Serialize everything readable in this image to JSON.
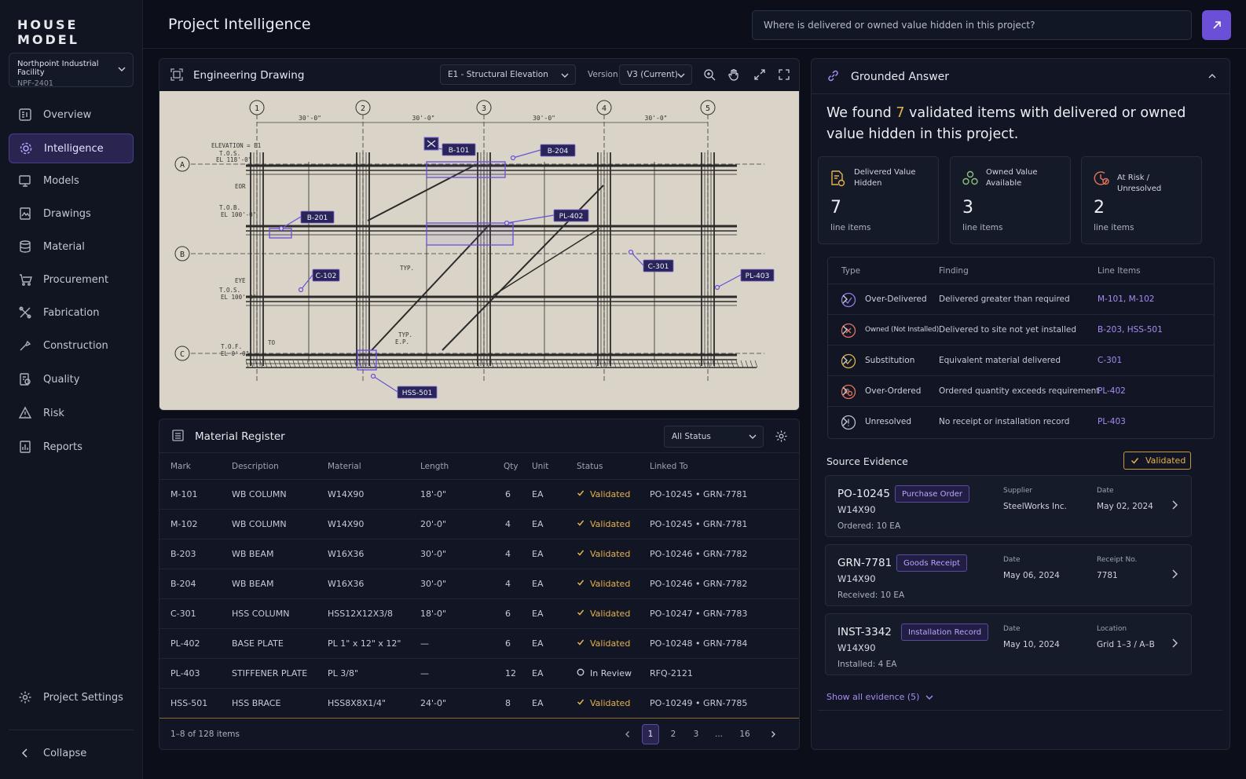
{
  "app": {
    "brand": "HOUSE MODEL"
  },
  "project": {
    "name": "Northpoint Industrial Facility",
    "code": "NPF-2401"
  },
  "nav": {
    "items": [
      {
        "label": "Overview",
        "icon": "overview-icon",
        "active": false
      },
      {
        "label": "Intelligence",
        "icon": "intelligence-icon",
        "active": true
      },
      {
        "label": "Models",
        "icon": "models-icon",
        "active": false
      },
      {
        "label": "Drawings",
        "icon": "drawings-icon",
        "active": false
      },
      {
        "label": "Material",
        "icon": "material-icon",
        "active": false
      },
      {
        "label": "Procurement",
        "icon": "procurement-icon",
        "active": false
      },
      {
        "label": "Fabrication",
        "icon": "fabrication-icon",
        "active": false
      },
      {
        "label": "Construction",
        "icon": "construction-icon",
        "active": false
      },
      {
        "label": "Quality",
        "icon": "quality-icon",
        "active": false
      },
      {
        "label": "Risk",
        "icon": "risk-icon",
        "active": false
      },
      {
        "label": "Reports",
        "icon": "reports-icon",
        "active": false
      }
    ],
    "settings_label": "Project Settings",
    "collapse_label": "Collapse"
  },
  "header": {
    "title": "Project Intelligence",
    "ask_placeholder": "Where is delivered or owned value hidden in this project?"
  },
  "drawing": {
    "title": "Engineering Drawing",
    "sheet": "E1 - Structural Elevation",
    "version_label": "Version",
    "version": "V3 (Current)",
    "grid_columns": [
      "1",
      "2",
      "3",
      "4",
      "5"
    ],
    "grid_rows": [
      "A",
      "B",
      "C"
    ],
    "spans": [
      "30'-0\"",
      "30'-0\"",
      "30'-0\"",
      "30'-0\""
    ],
    "notes": [
      "ELEVATION = E1",
      "T.O.S.",
      "EL 118'-0\"",
      "EOR",
      "T.O.B.",
      "EL 100'-0\"",
      "EYE",
      "T.O.S.",
      "EL 100'-0\"",
      "T.O.F.",
      "EL 0'-0\"",
      "TYP.",
      "TYP.",
      "E.P.",
      "TO"
    ],
    "callouts": [
      "B-101",
      "B-204",
      "B-201",
      "PL-402",
      "C-301",
      "C-102",
      "PL-403",
      "HSS-501"
    ]
  },
  "register": {
    "title": "Material Register",
    "filter": "All Status",
    "columns": [
      "Mark",
      "Description",
      "Material",
      "Length",
      "Qty",
      "Unit",
      "Status",
      "Linked To"
    ],
    "rows": [
      {
        "mark": "M-101",
        "desc": "WB COLUMN",
        "material": "W14X90",
        "length": "18'-0\"",
        "qty": "6",
        "unit": "EA",
        "status": "Validated",
        "linked": "PO-10245 • GRN-7781"
      },
      {
        "mark": "M-102",
        "desc": "WB COLUMN",
        "material": "W14X90",
        "length": "20'-0\"",
        "qty": "4",
        "unit": "EA",
        "status": "Validated",
        "linked": "PO-10245 • GRN-7781"
      },
      {
        "mark": "B-203",
        "desc": "WB BEAM",
        "material": "W16X36",
        "length": "30'-0\"",
        "qty": "4",
        "unit": "EA",
        "status": "Validated",
        "linked": "PO-10246 • GRN-7782"
      },
      {
        "mark": "B-204",
        "desc": "WB BEAM",
        "material": "W16X36",
        "length": "30'-0\"",
        "qty": "4",
        "unit": "EA",
        "status": "Validated",
        "linked": "PO-10246 • GRN-7782"
      },
      {
        "mark": "C-301",
        "desc": "HSS COLUMN",
        "material": "HSS12X12X3/8",
        "length": "18'-0\"",
        "qty": "6",
        "unit": "EA",
        "status": "Validated",
        "linked": "PO-10247 • GRN-7783"
      },
      {
        "mark": "PL-402",
        "desc": "BASE PLATE",
        "material": "PL 1\" x 12\" x 12\"",
        "length": "—",
        "qty": "6",
        "unit": "EA",
        "status": "Validated",
        "linked": "PO-10248 • GRN-7784"
      },
      {
        "mark": "PL-403",
        "desc": "STIFFENER PLATE",
        "material": "PL 3/8\"",
        "length": "—",
        "qty": "12",
        "unit": "EA",
        "status": "In Review",
        "linked": "RFQ-2121"
      },
      {
        "mark": "HSS-501",
        "desc": "HSS BRACE",
        "material": "HSS8X8X1/4\"",
        "length": "24'-0\"",
        "qty": "8",
        "unit": "EA",
        "status": "Validated",
        "linked": "PO-10249 • GRN-7785"
      }
    ],
    "footer": "1–8 of 128 items",
    "pages": [
      "1",
      "2",
      "3",
      "...",
      "16"
    ],
    "current_page": "1"
  },
  "answer": {
    "title": "Grounded Answer",
    "summary_pre": "We found ",
    "summary_num": "7",
    "summary_post": " validated items with delivered or owned value hidden in this project.",
    "stats": [
      {
        "label": "Delivered Value Hidden",
        "value": "7",
        "unit": "line items",
        "icon": "document-coin-icon"
      },
      {
        "label": "Owned Value Available",
        "value": "3",
        "unit": "line items",
        "icon": "stack-coins-icon"
      },
      {
        "label": "At Risk / Unresolved",
        "value": "2",
        "unit": "line items",
        "icon": "clock-alert-icon"
      }
    ],
    "findings_columns": [
      "Type",
      "Finding",
      "Line Items"
    ],
    "findings": [
      {
        "type": "Over-Delivered",
        "finding": "Delivered greater than required",
        "items": "M-101, M-102",
        "icon": "over-delivered-icon",
        "color": "#8b7be0"
      },
      {
        "type": "Owned (Not Installed)",
        "finding": "Delivered to site not yet installed",
        "items": "B-203, HSS-501",
        "icon": "owned-icon",
        "color": "#e0735a"
      },
      {
        "type": "Substitution",
        "finding": "Equivalent material delivered",
        "items": "C-301",
        "icon": "substitution-icon",
        "color": "#d8b54a"
      },
      {
        "type": "Over-Ordered",
        "finding": "Ordered quantity exceeds requirement",
        "items": "PL-402",
        "icon": "over-ordered-icon",
        "color": "#e0735a"
      },
      {
        "type": "Unresolved",
        "finding": "No receipt or installation record",
        "items": "PL-403",
        "icon": "unresolved-icon",
        "color": "#b9bcc8"
      }
    ],
    "evidence_title": "Source Evidence",
    "validated_label": "Validated",
    "evidence": [
      {
        "id": "PO-10245",
        "tag": "Purchase Order",
        "material": "W14X90",
        "qty": "Ordered: 10 EA",
        "k1": "Supplier",
        "v1": "SteelWorks Inc.",
        "k2": "Date",
        "v2": "May 02, 2024"
      },
      {
        "id": "GRN-7781",
        "tag": "Goods Receipt",
        "material": "W14X90",
        "qty": "Received: 10 EA",
        "k1": "Date",
        "v1": "May 06, 2024",
        "k2": "Receipt No.",
        "v2": "7781"
      },
      {
        "id": "INST-3342",
        "tag": "Installation Record",
        "material": "W14X90",
        "qty": "Installed: 4 EA",
        "k1": "Date",
        "v1": "May 10, 2024",
        "k2": "Location",
        "v2": "Grid 1–3 / A–B"
      }
    ],
    "show_all": "Show all evidence (5)"
  },
  "colors": {
    "accent": "#6b4fd6",
    "accent_text": "#a48cf2",
    "highlight": "#e6b24c"
  }
}
